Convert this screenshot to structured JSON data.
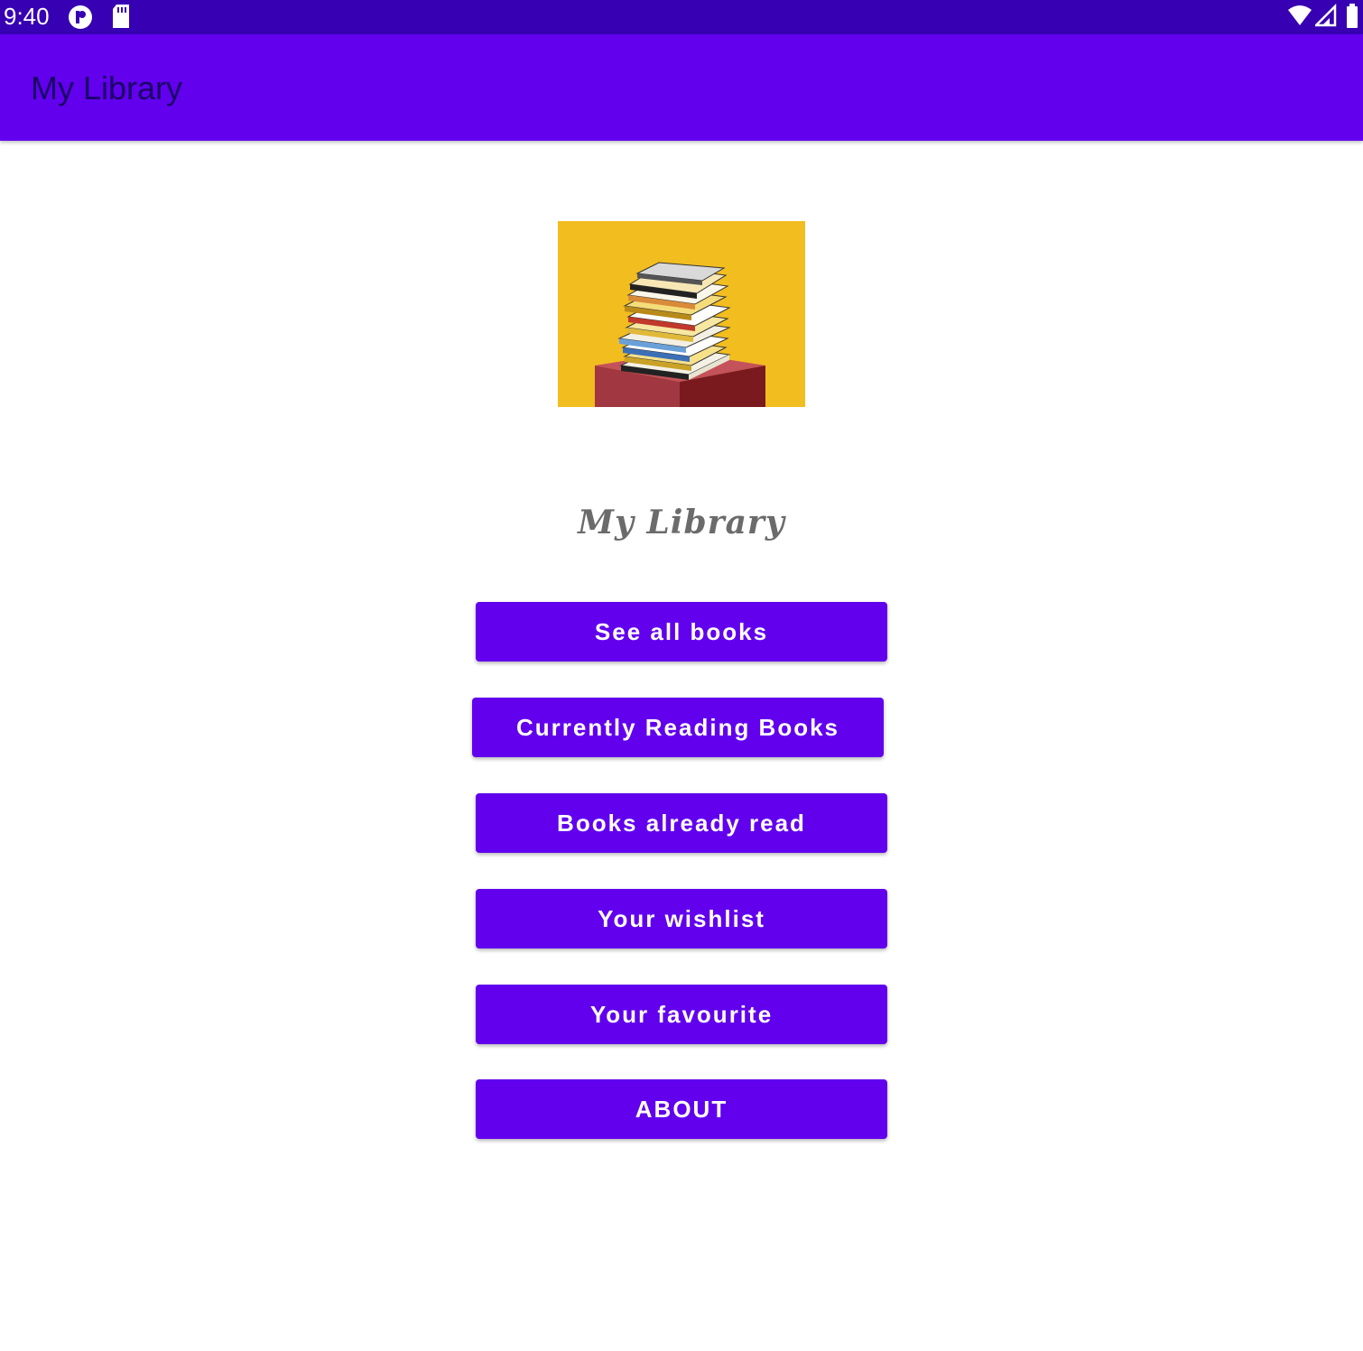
{
  "status_bar": {
    "time": "9:40",
    "icons": [
      "pocket-icon",
      "sd-card-icon",
      "wifi-icon",
      "signal-icon",
      "battery-icon"
    ]
  },
  "app_bar": {
    "title": "My Library"
  },
  "main": {
    "hero_image": "books-stack-image",
    "heading": "My Library",
    "buttons": [
      {
        "label": "See all books"
      },
      {
        "label": "Currently Reading Books"
      },
      {
        "label": "Books already read"
      },
      {
        "label": "Your wishlist"
      },
      {
        "label": "Your favourite"
      },
      {
        "label": "ABOUT"
      }
    ]
  },
  "colors": {
    "status_bar": "#3700b3",
    "primary": "#6200ee",
    "button_text": "#ffffff",
    "heading_text": "#6b6b6b",
    "image_background": "#f2bd1f"
  }
}
